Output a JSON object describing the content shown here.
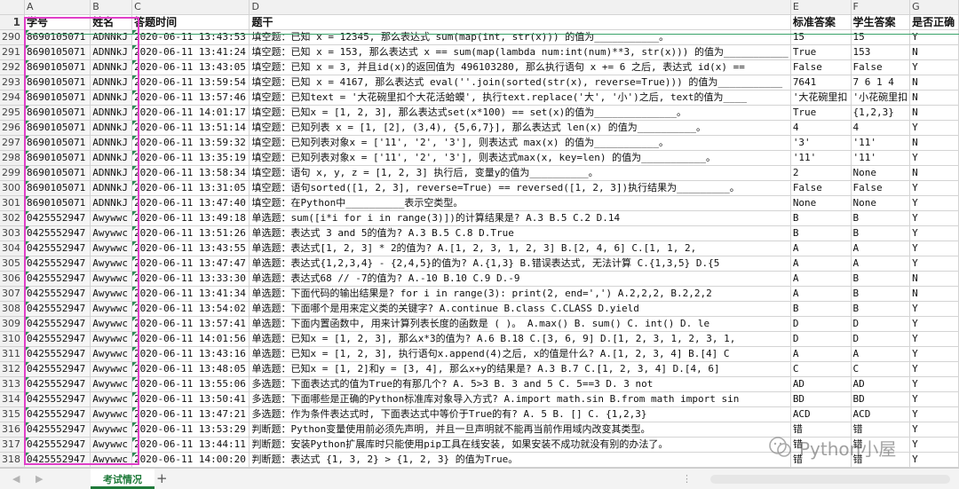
{
  "columns": [
    "A",
    "B",
    "C",
    "D",
    "E",
    "F",
    "G"
  ],
  "header": {
    "row_num": "1",
    "cells": [
      "学号",
      "姓名",
      "答题时间",
      "题干",
      "标准答案",
      "学生答案",
      "是否正确"
    ]
  },
  "rows": [
    {
      "n": "290",
      "c": [
        "8690105071",
        "ADNNkJ",
        "2020-06-11 13:43:53",
        "填空题：已知 x = 12345, 那么表达式 sum(map(int, str(x))) 的值为___________。",
        "15",
        "15",
        "Y"
      ]
    },
    {
      "n": "291",
      "c": [
        "8690105071",
        "ADNNkJ",
        "2020-06-11 13:41:24",
        "填空题：已知 x = 153, 那么表达式 x == sum(map(lambda num:int(num)**3, str(x))) 的值为___________",
        "True",
        "153",
        "N"
      ]
    },
    {
      "n": "292",
      "c": [
        "8690105071",
        "ADNNkJ",
        "2020-06-11 13:43:05",
        "填空题：已知 x = 3, 并且id(x)的返回值为 496103280, 那么执行语句 x += 6 之后, 表达式 id(x) ==",
        "False",
        "False",
        "Y"
      ]
    },
    {
      "n": "293",
      "c": [
        "8690105071",
        "ADNNkJ",
        "2020-06-11 13:59:54",
        "填空题：已知 x = 4167, 那么表达式 eval(''.join(sorted(str(x), reverse=True))) 的值为___________",
        "7641",
        "7 6 1 4",
        "N"
      ]
    },
    {
      "n": "294",
      "c": [
        "8690105071",
        "ADNNkJ",
        "2020-06-11 13:57:46",
        "填空题：已知text = '大花碗里扣个大花活蛤蟆', 执行text.replace('大', '小')之后, text的值为____",
        "'大花碗里扣",
        "'小花碗里扣",
        "N"
      ]
    },
    {
      "n": "295",
      "c": [
        "8690105071",
        "ADNNkJ",
        "2020-06-11 14:01:17",
        "填空题：已知x = [1, 2, 3], 那么表达式set(x*100) == set(x)的值为______________。",
        "True",
        "{1,2,3}",
        "N"
      ]
    },
    {
      "n": "296",
      "c": [
        "8690105071",
        "ADNNkJ",
        "2020-06-11 13:51:14",
        "填空题：已知列表 x = [1, [2], (3,4), {5,6,7}], 那么表达式 len(x) 的值为__________。",
        "4",
        "4",
        "Y"
      ]
    },
    {
      "n": "297",
      "c": [
        "8690105071",
        "ADNNkJ",
        "2020-06-11 13:59:32",
        "填空题：已知列表对象x = ['11', '2', '3'], 则表达式 max(x) 的值为___________。",
        "'3'",
        "'11'",
        "N"
      ]
    },
    {
      "n": "298",
      "c": [
        "8690105071",
        "ADNNkJ",
        "2020-06-11 13:35:19",
        "填空题：已知列表对象x = ['11', '2', '3'], 则表达式max(x, key=len) 的值为___________。",
        "'11'",
        "'11'",
        "Y"
      ]
    },
    {
      "n": "299",
      "c": [
        "8690105071",
        "ADNNkJ",
        "2020-06-11 13:58:34",
        "填空题：语句 x, y, z = [1, 2, 3] 执行后, 变量y的值为__________。",
        "2",
        "None",
        "N"
      ]
    },
    {
      "n": "300",
      "c": [
        "8690105071",
        "ADNNkJ",
        "2020-06-11 13:31:05",
        "填空题：语句sorted([1, 2, 3], reverse=True) == reversed([1, 2, 3])执行结果为_________。",
        "False",
        "False",
        "Y"
      ]
    },
    {
      "n": "301",
      "c": [
        "8690105071",
        "ADNNkJ",
        "2020-06-11 13:47:40",
        "填空题：在Python中__________表示空类型。",
        "None",
        "None",
        "Y"
      ]
    },
    {
      "n": "302",
      "c": [
        "0425552947",
        "Awywwc",
        "2020-06-11 13:49:18",
        "单选题：sum([i*i for i in range(3)])的计算结果是? A.3    B.5    C.2    D.14",
        "B",
        "B",
        "Y"
      ]
    },
    {
      "n": "303",
      "c": [
        "0425552947",
        "Awywwc",
        "2020-06-11 13:51:26",
        "单选题：表达式 3 and 5的值为? A.3      B.5      C.8      D.True",
        "B",
        "B",
        "Y"
      ]
    },
    {
      "n": "304",
      "c": [
        "0425552947",
        "Awywwc",
        "2020-06-11 13:43:55",
        "单选题：表达式[1, 2, 3] * 2的值为? A.[1, 2, 3, 1, 2, 3]          B.[2, 4, 6]       C.[1, 1, 2,",
        "A",
        "A",
        "Y"
      ]
    },
    {
      "n": "305",
      "c": [
        "0425552947",
        "Awywwc",
        "2020-06-11 13:47:47",
        "单选题：表达式{1,2,3,4} - {2,4,5}的值为? A.{1,3}  B.错误表达式, 无法计算    C.{1,3,5}    D.{5",
        "A",
        "A",
        "Y"
      ]
    },
    {
      "n": "306",
      "c": [
        "0425552947",
        "Awywwc",
        "2020-06-11 13:33:30",
        "单选题：表达式68 // -7的值为? A.-10    B.10    C.9    D.-9",
        "A",
        "B",
        "N"
      ]
    },
    {
      "n": "307",
      "c": [
        "0425552947",
        "Awywwc",
        "2020-06-11 13:41:34",
        "单选题：下面代码的输出结果是? for  i  in  range(3):  print(2,  end=',')  A.2,2,2,       B.2,2,2",
        "A",
        "B",
        "N"
      ]
    },
    {
      "n": "308",
      "c": [
        "0425552947",
        "Awywwc",
        "2020-06-11 13:54:02",
        "单选题：下面哪个是用来定义类的关键字? A.continue      B.class       C.CLASS     D.yield",
        "B",
        "B",
        "Y"
      ]
    },
    {
      "n": "309",
      "c": [
        "0425552947",
        "Awywwc",
        "2020-06-11 13:57:41",
        "单选题：下面内置函数中, 用来计算列表长度的函数是 ( )。  A.max()   B. sum()   C. int()  D. le",
        "D",
        "D",
        "Y"
      ]
    },
    {
      "n": "310",
      "c": [
        "0425552947",
        "Awywwc",
        "2020-06-11 14:01:56",
        "单选题：已知x = [1, 2, 3], 那么x*3的值为? A.6    B.18    C.[3, 6, 9]   D.[1, 2, 3, 1, 2, 3, 1,",
        "D",
        "D",
        "Y"
      ]
    },
    {
      "n": "311",
      "c": [
        "0425552947",
        "Awywwc",
        "2020-06-11 13:43:16",
        "单选题：已知x = [1, 2, 3], 执行语句x.append(4)之后, x的值是什么? A.[1, 2, 3, 4]     B.[4]     C",
        "A",
        "A",
        "Y"
      ]
    },
    {
      "n": "312",
      "c": [
        "0425552947",
        "Awywwc",
        "2020-06-11 13:48:05",
        "单选题：已知x = [1, 2]和y = [3, 4], 那么x+y的结果是? A.3     B.7      C.[1, 2, 3, 4]      D.[4, 6]",
        "C",
        "C",
        "Y"
      ]
    },
    {
      "n": "313",
      "c": [
        "0425552947",
        "Awywwc",
        "2020-06-11 13:55:06",
        "多选题：下面表达式的值为True的有那几个? A. 5>3          B. 3 and 5      C. 5==3          D. 3 not",
        "AD",
        "AD",
        "Y"
      ]
    },
    {
      "n": "314",
      "c": [
        "0425552947",
        "Awywwc",
        "2020-06-11 13:50:41",
        "多选题：下面哪些是正确的Python标准库对象导入方式? A.import math.sin    B.from math import sin",
        "BD",
        "BD",
        "Y"
      ]
    },
    {
      "n": "315",
      "c": [
        "0425552947",
        "Awywwc",
        "2020-06-11 13:47:21",
        "多选题：作为条件表达式时, 下面表达式中等价于True的有? A. 5        B.  []         C.  {1,2,3}",
        "ACD",
        "ACD",
        "Y"
      ]
    },
    {
      "n": "316",
      "c": [
        "0425552947",
        "Awywwc",
        "2020-06-11 13:53:29",
        "判断题：Python变量使用前必须先声明, 并且一旦声明就不能再当前作用域内改变其类型。",
        "错",
        "错",
        "Y"
      ]
    },
    {
      "n": "317",
      "c": [
        "0425552947",
        "Awywwc",
        "2020-06-11 13:44:11",
        "判断题：安装Python扩展库时只能使用pip工具在线安装, 如果安装不成功就没有别的办法了。",
        "错",
        "错",
        "Y"
      ]
    },
    {
      "n": "318",
      "c": [
        "0425552947",
        "Awywwc",
        "2020-06-11 14:00:20",
        "判断题：表达式 {1, 3, 2} > {1, 2, 3} 的值为True。",
        "错",
        "错",
        "Y"
      ]
    }
  ],
  "sheet_tab": "考试情况",
  "add_sheet_icon": "+",
  "nav": {
    "prev": "◀",
    "next": "▶"
  },
  "watermark_text": "Python小屋",
  "colors": {
    "accent": "#1f7a3a",
    "highlight": "#e040c8",
    "header_bg": "#f1f1f1"
  }
}
